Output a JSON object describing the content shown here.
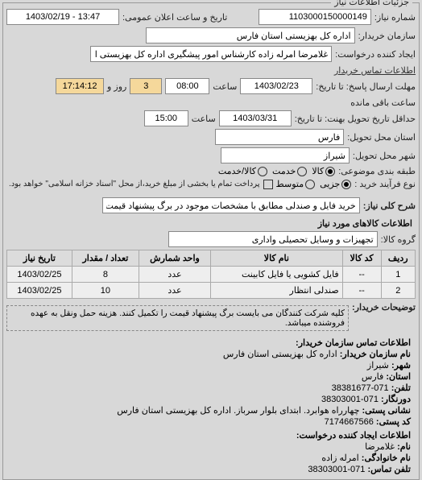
{
  "panel_title": "جزئیات اطلاعات نیاز",
  "row1": {
    "num_label": "شماره نیاز:",
    "num_value": "1103000150000149",
    "pub_label": "تاریخ و ساعت اعلان عمومی:",
    "pub_value": "13:47 - 1403/02/19"
  },
  "row2": {
    "buyer_label": "سازمان خریدار:",
    "buyer_value": "اداره کل بهزیستی استان فارس"
  },
  "row3": {
    "creator_label": "ایجاد کننده درخواست:",
    "creator_value": "غلامرضا امرله زاده کارشناس امور پیشگیری اداره کل بهزیستی استان فارس",
    "contact_link": "اطلاعات تماس خریدار"
  },
  "row4": {
    "deadline_label": "مهلت ارسال پاسخ: تا تاریخ:",
    "date_value": "1403/02/23",
    "time_label": "ساعت",
    "time_value": "08:00",
    "days_value": "3",
    "days_label": "روز و",
    "remain_value": "17:14:12",
    "remain_label": "ساعت باقی مانده"
  },
  "row5": {
    "delivery_label": "حداقل تاریخ تحویل بهنت: تا تاریخ:",
    "date_value": "1403/03/31",
    "time_label": "ساعت",
    "time_value": "15:00"
  },
  "row6": {
    "state_label": "استان محل تحویل:",
    "state_value": "فارس"
  },
  "row7": {
    "city_label": "شهر محل تحویل:",
    "city_value": "شیراز"
  },
  "row8": {
    "class_label": "طبقه بندی موضوعی:",
    "opt_kala": "کالا",
    "opt_khadamat": "خدمت",
    "opt_kala_khadamat": "کالا/خدمت"
  },
  "row9": {
    "proc_label": "نوع فرآیند خرید :",
    "opt_joz": "جزیی",
    "opt_mot": "متوسط",
    "pay_text": "پرداخت تمام یا بخشی از مبلغ خرید،از محل \"اسناد خزانه اسلامی\" خواهد بود."
  },
  "row10": {
    "desc_label": "شرح کلی نیاز:",
    "desc_value": "خرید فایل و صندلی مطابق با مشخصات موجود در برگ پیشنهاد قیمت"
  },
  "goods_title": "اطلاعات کالاهای مورد نیاز",
  "row11": {
    "group_label": "گروه کالا:",
    "group_value": "تجهیزات و وسایل تحصیلی واداری"
  },
  "table": {
    "headers": [
      "ردیف",
      "کد کالا",
      "نام کالا",
      "واحد شمارش",
      "تعداد / مقدار",
      "تاریخ نیاز"
    ],
    "rows": [
      {
        "idx": "1",
        "code": "--",
        "name": "فایل کشویی یا فایل کابینت",
        "unit": "عدد",
        "qty": "8",
        "date": "1403/02/25"
      },
      {
        "idx": "2",
        "code": "--",
        "name": "صندلی انتظار",
        "unit": "عدد",
        "qty": "10",
        "date": "1403/02/25"
      }
    ]
  },
  "buyer_notes": {
    "label": "توضیحات خریدار:",
    "text": "کلیه شرکت کنندگان می بایست برگ پیشنهاد قیمت را تکمیل کنند. هزینه حمل ونقل به عهده فروشنده میباشد."
  },
  "contact_block": {
    "title": "اطلاعات تماس سازمان خریدار:",
    "org_label": "نام سازمان خریدار:",
    "org": "اداره کل بهزیستی استان فارس",
    "city_label": "شهر:",
    "city": "شیراز",
    "state_label": "استان:",
    "state": "فارس",
    "phone_label": "تلفن:",
    "phone": "071-38381677",
    "fax_label": "دورنگار:",
    "fax": "071-38303001",
    "postal_label": "نشانی پستی:",
    "postal": "چهارراه هوابرد. ابتدای بلوار سرباز. اداره کل بهزیستی استان فارس",
    "pcode_label": "کد پستی:",
    "pcode": "7174667566"
  },
  "creator_block": {
    "title": "اطلاعات ایجاد کننده درخواست:",
    "fname_label": "نام:",
    "fname": "غلامرضا",
    "lname_label": "نام خانوادگی:",
    "lname": "امرله زاده",
    "phone_label": "تلفن تماس:",
    "phone": "071-38303001"
  }
}
